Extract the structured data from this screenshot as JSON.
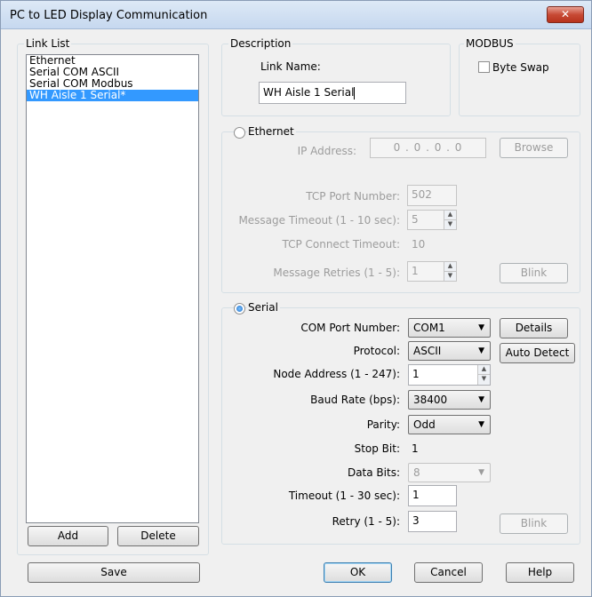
{
  "window": {
    "title": "PC to LED Display Communication",
    "close_glyph": "✕"
  },
  "link_list": {
    "title": "Link List",
    "items": [
      {
        "label": "Ethernet",
        "selected": false
      },
      {
        "label": "Serial COM ASCII",
        "selected": false
      },
      {
        "label": "Serial COM Modbus",
        "selected": false
      },
      {
        "label": "WH Aisle 1 Serial*",
        "selected": true
      }
    ],
    "add_label": "Add",
    "delete_label": "Delete"
  },
  "description": {
    "title": "Description",
    "link_name_label": "Link Name:",
    "link_name_value": "WH Aisle 1 Serial"
  },
  "modbus": {
    "title": "MODBUS",
    "byte_swap_label": "Byte Swap",
    "byte_swap_checked": false
  },
  "ethernet": {
    "title": "Ethernet",
    "selected": false,
    "ip_label": "IP Address:",
    "ip_value": "0 . 0 . 0 . 0",
    "browse_label": "Browse",
    "tcp_port_label": "TCP Port Number:",
    "tcp_port_value": "502",
    "msg_timeout_label": "Message Timeout (1 - 10 sec):",
    "msg_timeout_value": "5",
    "tcp_connect_label": "TCP Connect Timeout:",
    "tcp_connect_value": "10",
    "msg_retries_label": "Message Retries (1 - 5):",
    "msg_retries_value": "1",
    "blink_label": "Blink"
  },
  "serial": {
    "title": "Serial",
    "selected": true,
    "com_port_label": "COM Port Number:",
    "com_port_value": "COM1",
    "details_label": "Details",
    "protocol_label": "Protocol:",
    "protocol_value": "ASCII",
    "auto_detect_label": "Auto Detect",
    "node_address_label": "Node Address (1 - 247):",
    "node_address_value": "1",
    "baud_rate_label": "Baud Rate (bps):",
    "baud_rate_value": "38400",
    "parity_label": "Parity:",
    "parity_value": "Odd",
    "stop_bit_label": "Stop Bit:",
    "stop_bit_value": "1",
    "data_bits_label": "Data Bits:",
    "data_bits_value": "8",
    "timeout_label": "Timeout (1 - 30 sec):",
    "timeout_value": "1",
    "retry_label": "Retry (1 - 5):",
    "retry_value": "3",
    "blink_label": "Blink"
  },
  "footer": {
    "save_label": "Save",
    "ok_label": "OK",
    "cancel_label": "Cancel",
    "help_label": "Help"
  },
  "icons": {
    "dropdown_arrow": "▼",
    "spin_up": "▲",
    "spin_down": "▼"
  },
  "colors": {
    "selection": "#3399ff",
    "close_button": "#c74a35"
  }
}
